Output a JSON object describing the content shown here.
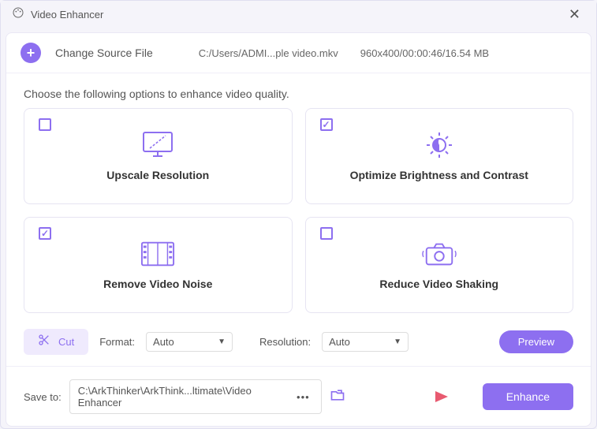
{
  "window": {
    "title": "Video Enhancer"
  },
  "source": {
    "button_label": "Change Source File",
    "path": "C:/Users/ADMI...ple video.mkv",
    "meta": "960x400/00:00:46/16.54 MB"
  },
  "instruction": "Choose the following options to enhance video quality.",
  "options": [
    {
      "label": "Upscale Resolution",
      "checked": false
    },
    {
      "label": "Optimize Brightness and Contrast",
      "checked": true
    },
    {
      "label": "Remove Video Noise",
      "checked": true
    },
    {
      "label": "Reduce Video Shaking",
      "checked": false
    }
  ],
  "controls": {
    "cut_label": "Cut",
    "format_label": "Format:",
    "format_value": "Auto",
    "resolution_label": "Resolution:",
    "resolution_value": "Auto",
    "preview_label": "Preview"
  },
  "save": {
    "label": "Save to:",
    "path": "C:\\ArkThinker\\ArkThink...ltimate\\Video Enhancer",
    "enhance_label": "Enhance"
  }
}
